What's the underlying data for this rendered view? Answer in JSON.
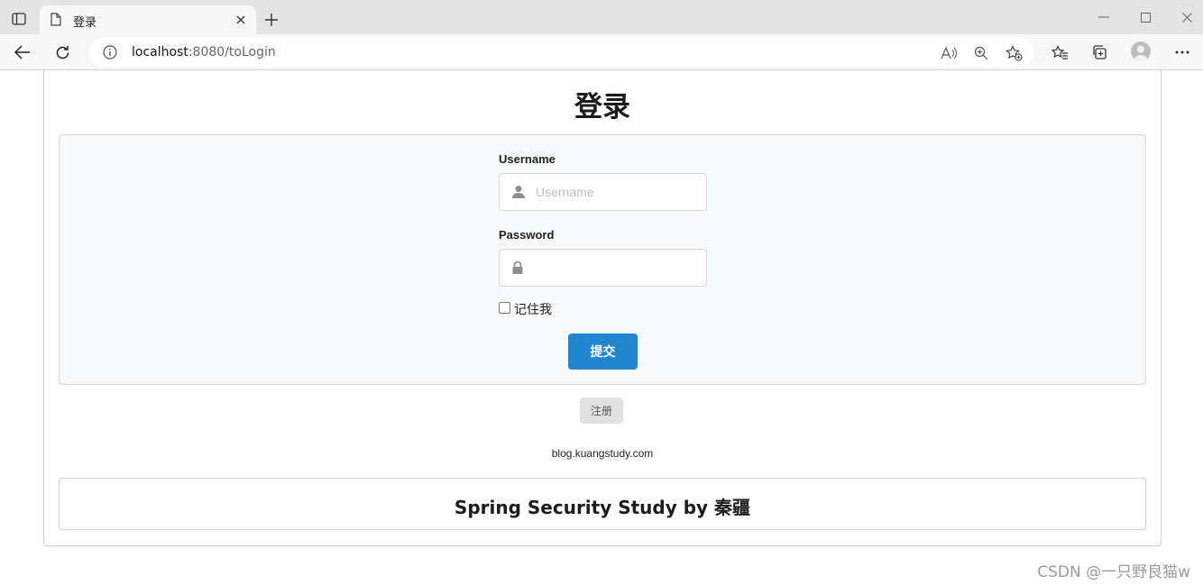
{
  "browser": {
    "tab_title": "登录",
    "url_host": "localhost",
    "url_rest": ":8080/toLogin"
  },
  "page": {
    "title": "登录",
    "username_label": "Username",
    "username_placeholder": "Username",
    "password_label": "Password",
    "password_value": "",
    "remember_label": "记住我",
    "remember_checked": false,
    "submit_label": "提交",
    "register_label": "注册",
    "site_link": "blog.kuangstudy.com",
    "footer_text": "Spring Security Study by 秦疆"
  },
  "watermark": "CSDN @一只野良猫w",
  "colors": {
    "primary": "#2185d0",
    "secondary": "#e0e1e2",
    "segment_bg": "#f8f9fa"
  }
}
